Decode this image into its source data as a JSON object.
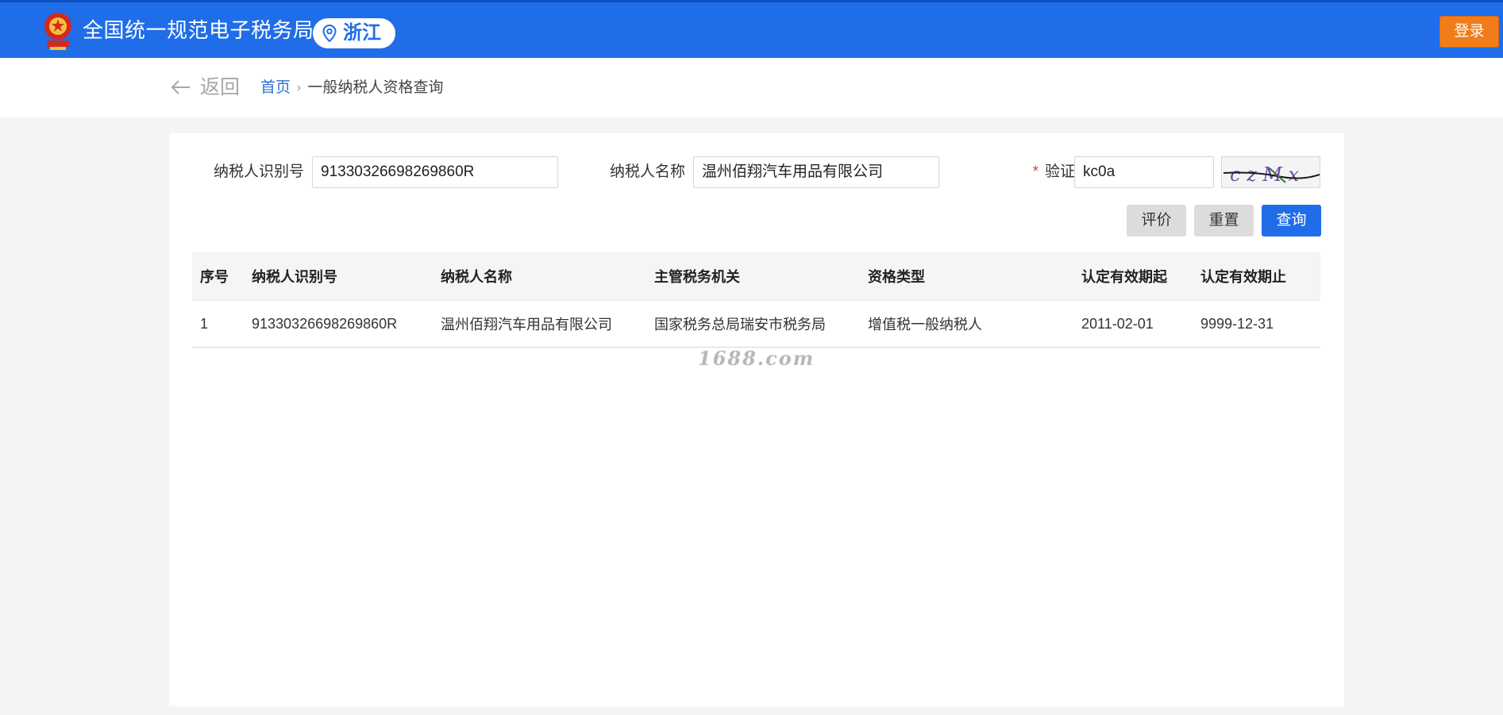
{
  "header": {
    "site_title": "全国统一规范电子税务局",
    "region": "浙江",
    "login_label": "登录",
    "colors": {
      "bar": "#1f6de8",
      "login": "#f07d1a"
    }
  },
  "nav": {
    "back_label": "返回",
    "breadcrumb_home": "首页",
    "breadcrumb_separator": "›",
    "breadcrumb_current": "一般纳税人资格查询"
  },
  "form": {
    "taxpayer_id_label": "纳税人识别号",
    "taxpayer_id_value": "91330326698269860R",
    "taxpayer_name_label": "纳税人名称",
    "taxpayer_name_value": "温州佰翔汽车用品有限公司",
    "captcha_required_mark": "*",
    "captcha_label": "验证码",
    "captcha_value": "kc0a",
    "captcha_image_text": "c z M x"
  },
  "buttons": {
    "evaluate": "评价",
    "reset": "重置",
    "query": "查询"
  },
  "table": {
    "columns": [
      "序号",
      "纳税人识别号",
      "纳税人名称",
      "主管税务机关",
      "资格类型",
      "认定有效期起",
      "认定有效期止"
    ],
    "rows": [
      [
        "1",
        "91330326698269860R",
        "温州佰翔汽车用品有限公司",
        "国家税务总局瑞安市税务局",
        "增值税一般纳税人",
        "2011-02-01",
        "9999-12-31"
      ]
    ]
  },
  "watermark": "1688.com"
}
